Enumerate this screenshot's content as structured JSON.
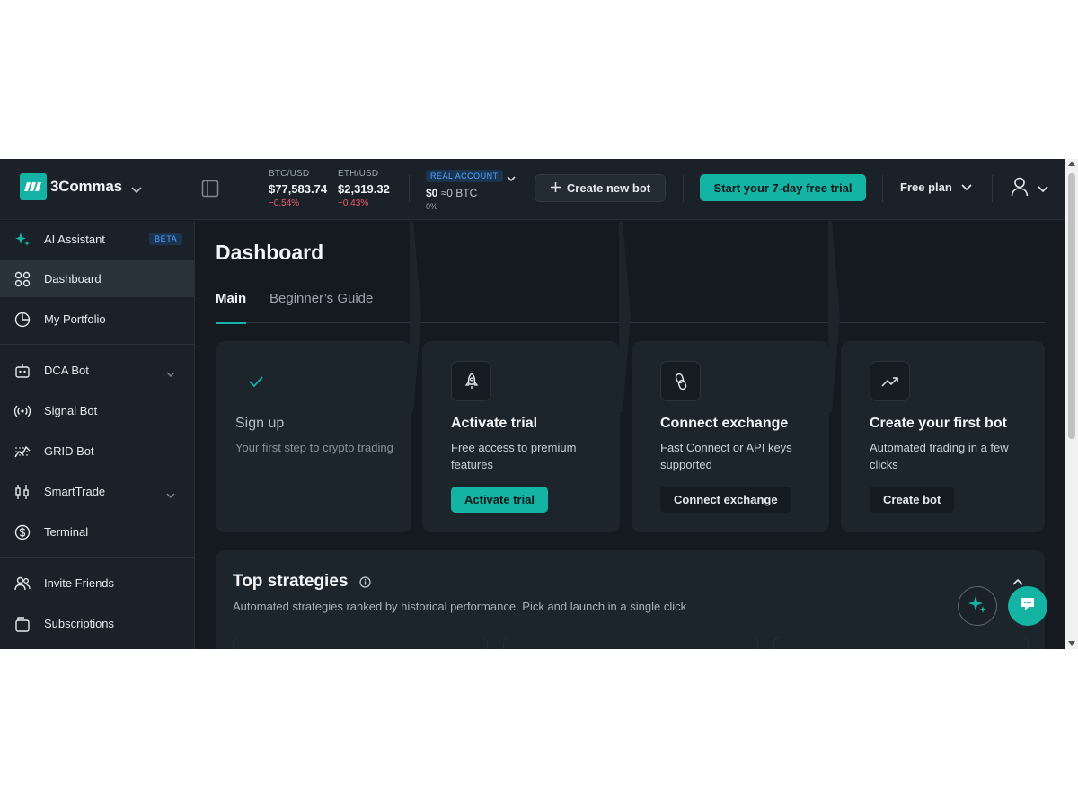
{
  "header": {
    "brand": "3Commas",
    "tickers": [
      {
        "pair": "BTC/USD",
        "price": "$77,583.74",
        "change": "−0.54%"
      },
      {
        "pair": "ETH/USD",
        "price": "$2,319.32",
        "change": "−0.43%"
      }
    ],
    "account": {
      "badge": "REAL ACCOUNT",
      "balance_usd": "$0",
      "balance_btc": "≈0 BTC",
      "change": "0%"
    },
    "create_bot_label": "Create new bot",
    "trial_label": "Start your 7-day free trial",
    "plan_label": "Free plan"
  },
  "sidebar": {
    "items": [
      {
        "label": "AI Assistant",
        "icon": "sparkle-icon",
        "badge": "BETA"
      },
      {
        "label": "Dashboard",
        "icon": "grid-icon"
      },
      {
        "label": "My Portfolio",
        "icon": "pie-chart-icon"
      },
      {
        "label": "DCA Bot",
        "icon": "robot-icon"
      },
      {
        "label": "Signal Bot",
        "icon": "signal-icon"
      },
      {
        "label": "GRID Bot",
        "icon": "grid-chart-icon"
      },
      {
        "label": "SmartTrade",
        "icon": "candlestick-icon"
      },
      {
        "label": "Terminal",
        "icon": "coin-icon"
      },
      {
        "label": "Invite Friends",
        "icon": "users-icon"
      },
      {
        "label": "Subscriptions",
        "icon": "wallet-icon"
      }
    ]
  },
  "main": {
    "title": "Dashboard",
    "tabs": [
      {
        "label": "Main"
      },
      {
        "label": "Beginner’s Guide"
      }
    ],
    "steps": [
      {
        "title": "Sign up",
        "desc": "Your first step to crypto trading",
        "icon": "check-icon"
      },
      {
        "title": "Activate trial",
        "desc": "Free access to premium features",
        "button": "Activate trial",
        "icon": "rocket-icon"
      },
      {
        "title": "Connect exchange",
        "desc": "Fast Connect or API keys supported",
        "button": "Connect exchange",
        "icon": "link-icon"
      },
      {
        "title": "Create your first bot",
        "desc": "Automated trading in a few clicks",
        "button": "Create bot",
        "icon": "trend-up-icon"
      }
    ],
    "strategies": {
      "title": "Top strategies",
      "subtitle": "Automated strategies ranked by historical performance. Pick and launch in a single click"
    }
  },
  "colors": {
    "accent": "#14b3a3",
    "negative": "#f0596b",
    "badge_blue": "#4da3ff",
    "background": "#141a20"
  }
}
